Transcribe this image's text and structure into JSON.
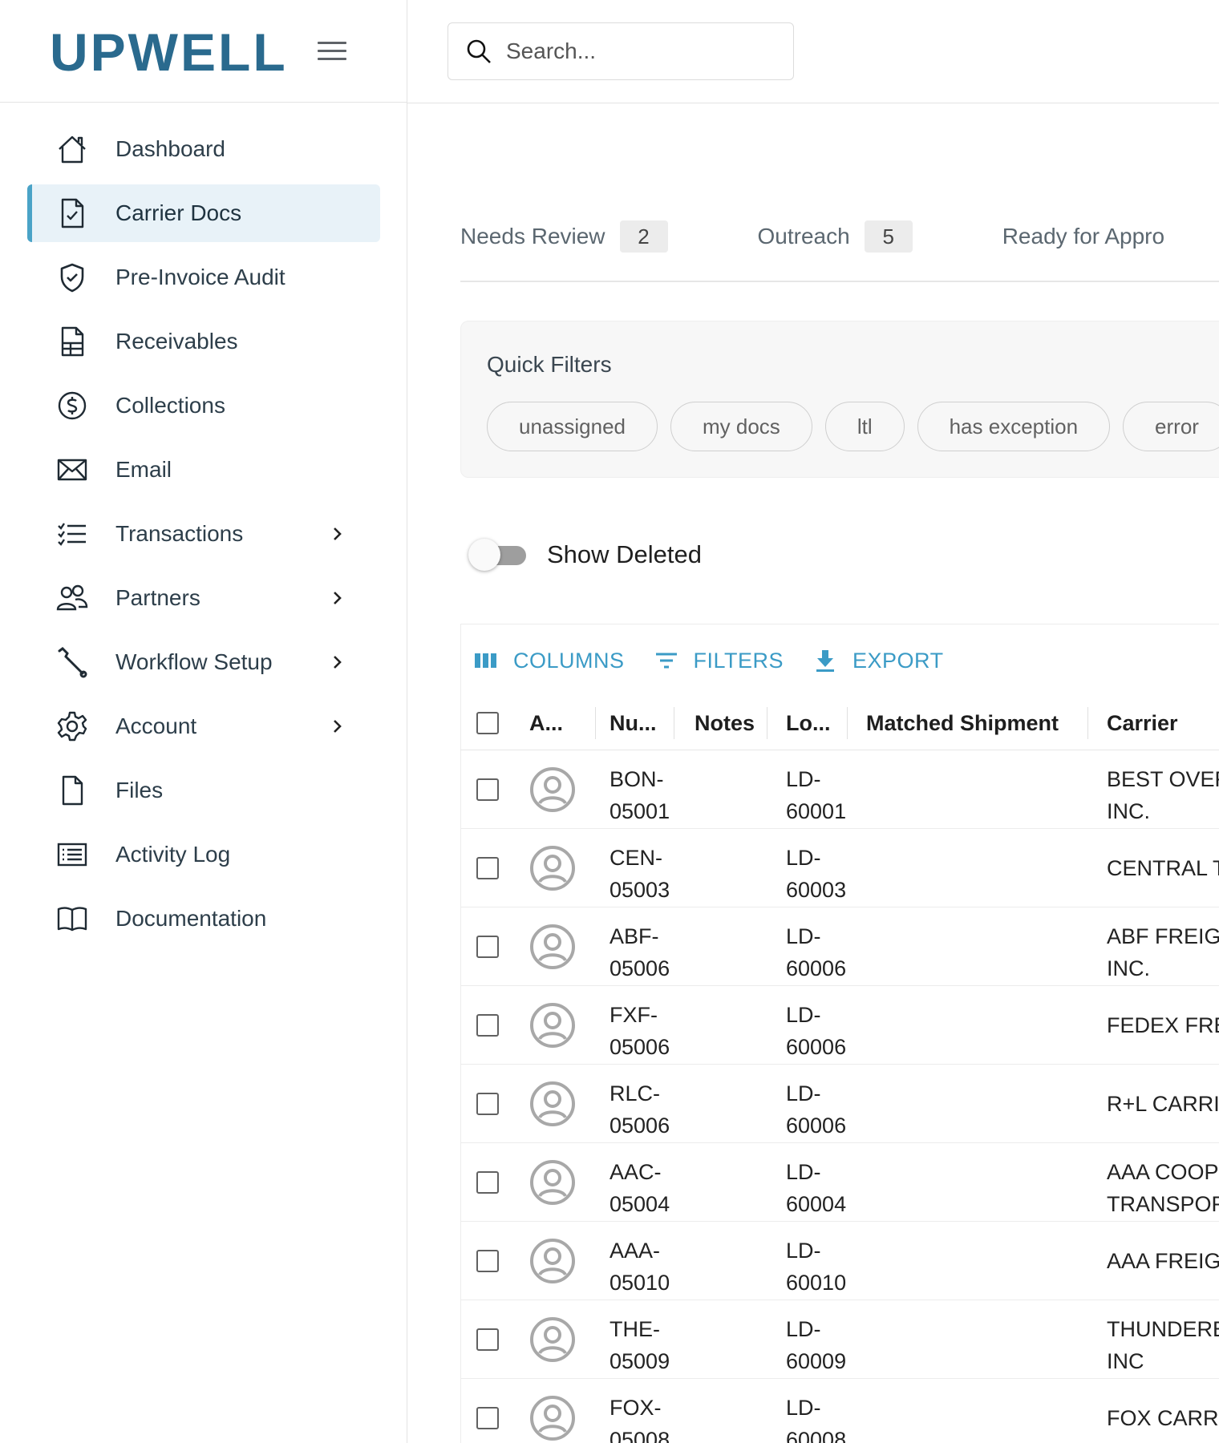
{
  "brand": {
    "logo_text": "UPWELL",
    "accent": "#2a6a8e",
    "accent_light": "#5fc7e3"
  },
  "search": {
    "placeholder": "Search..."
  },
  "sidebar": {
    "items": [
      {
        "label": "Dashboard",
        "icon": "home-icon",
        "expandable": false,
        "active": false
      },
      {
        "label": "Carrier Docs",
        "icon": "document-check-icon",
        "expandable": false,
        "active": true
      },
      {
        "label": "Pre-Invoice Audit",
        "icon": "shield-check-icon",
        "expandable": false,
        "active": false
      },
      {
        "label": "Receivables",
        "icon": "ledger-document-icon",
        "expandable": false,
        "active": false
      },
      {
        "label": "Collections",
        "icon": "dollar-circle-icon",
        "expandable": false,
        "active": false
      },
      {
        "label": "Email",
        "icon": "envelope-icon",
        "expandable": false,
        "active": false
      },
      {
        "label": "Transactions",
        "icon": "checklist-icon",
        "expandable": true,
        "active": false
      },
      {
        "label": "Partners",
        "icon": "people-icon",
        "expandable": true,
        "active": false
      },
      {
        "label": "Workflow Setup",
        "icon": "wrench-icon",
        "expandable": true,
        "active": false
      },
      {
        "label": "Account",
        "icon": "gear-icon",
        "expandable": true,
        "active": false
      },
      {
        "label": "Files",
        "icon": "file-icon",
        "expandable": false,
        "active": false
      },
      {
        "label": "Activity Log",
        "icon": "list-box-icon",
        "expandable": false,
        "active": false
      },
      {
        "label": "Documentation",
        "icon": "book-icon",
        "expandable": false,
        "active": false
      }
    ]
  },
  "tabs": [
    {
      "label": "Needs Review",
      "count": "2"
    },
    {
      "label": "Outreach",
      "count": "5"
    },
    {
      "label": "Ready for Appro",
      "count": ""
    }
  ],
  "quick_filters": {
    "title": "Quick Filters",
    "chips": [
      "unassigned",
      "my docs",
      "ltl",
      "has exception",
      "error"
    ]
  },
  "show_deleted": {
    "label": "Show Deleted",
    "checked": false
  },
  "toolbar": {
    "columns": "COLUMNS",
    "filters": "FILTERS",
    "export": "EXPORT",
    "color": "#3b9bc6"
  },
  "grid": {
    "headers": {
      "assignee": "A...",
      "number": "Nu...",
      "notes": "Notes",
      "load": "Lo...",
      "matched": "Matched Shipment",
      "carrier": "Carrier"
    },
    "rows": [
      {
        "num_1": "BON-",
        "num_2": "05001",
        "load_1": "LD-",
        "load_2": "60001",
        "carrier_1": "BEST OVER",
        "carrier_2": "INC."
      },
      {
        "num_1": "CEN-",
        "num_2": "05003",
        "load_1": "LD-",
        "load_2": "60003",
        "carrier_1": "CENTRAL T",
        "carrier_2": ""
      },
      {
        "num_1": "ABF-",
        "num_2": "05006",
        "load_1": "LD-",
        "load_2": "60006",
        "carrier_1": "ABF FREIG",
        "carrier_2": "INC."
      },
      {
        "num_1": "FXF-",
        "num_2": "05006",
        "load_1": "LD-",
        "load_2": "60006",
        "carrier_1": "FEDEX FRE",
        "carrier_2": ""
      },
      {
        "num_1": "RLC-",
        "num_2": "05006",
        "load_1": "LD-",
        "load_2": "60006",
        "carrier_1": "R+L CARRI",
        "carrier_2": ""
      },
      {
        "num_1": "AAC-",
        "num_2": "05004",
        "load_1": "LD-",
        "load_2": "60004",
        "carrier_1": "AAA COOP",
        "carrier_2": "TRANSPOR"
      },
      {
        "num_1": "AAA-",
        "num_2": "05010",
        "load_1": "LD-",
        "load_2": "60010",
        "carrier_1": "AAA FREIG",
        "carrier_2": ""
      },
      {
        "num_1": "THE-",
        "num_2": "05009",
        "load_1": "LD-",
        "load_2": "60009",
        "carrier_1": "THUNDERE",
        "carrier_2": "INC"
      },
      {
        "num_1": "FOX-",
        "num_2": "05008",
        "load_1": "LD-",
        "load_2": "60008",
        "carrier_1": "FOX CARRI",
        "carrier_2": ""
      }
    ]
  }
}
